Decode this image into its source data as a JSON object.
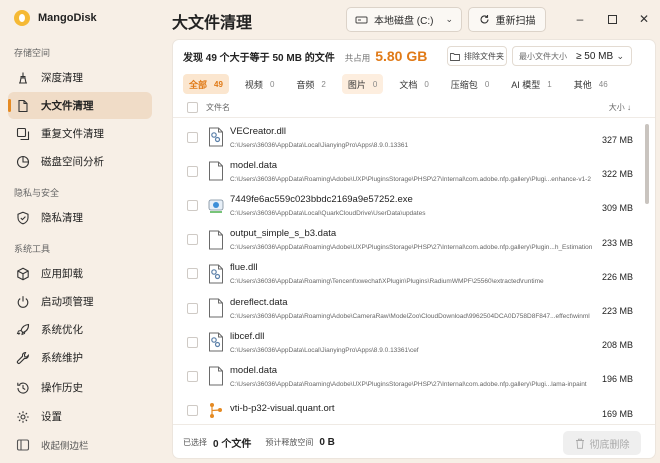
{
  "app": {
    "name": "MangoDisk"
  },
  "sidebar": {
    "sections": [
      {
        "title": "存储空间",
        "items": [
          {
            "label": "深度清理",
            "icon": "broom-icon",
            "active": false
          },
          {
            "label": "大文件清理",
            "icon": "large-file-icon",
            "active": true
          },
          {
            "label": "重复文件清理",
            "icon": "duplicate-icon",
            "active": false
          },
          {
            "label": "磁盘空间分析",
            "icon": "pie-chart-icon",
            "active": false
          }
        ]
      },
      {
        "title": "隐私与安全",
        "items": [
          {
            "label": "隐私清理",
            "icon": "shield-icon",
            "active": false
          }
        ]
      },
      {
        "title": "系统工具",
        "items": [
          {
            "label": "应用卸载",
            "icon": "box-icon",
            "active": false
          },
          {
            "label": "启动项管理",
            "icon": "power-icon",
            "active": false
          },
          {
            "label": "系统优化",
            "icon": "rocket-icon",
            "active": false
          },
          {
            "label": "系统维护",
            "icon": "wrench-icon",
            "active": false
          }
        ]
      }
    ],
    "bottom": [
      {
        "label": "操作历史",
        "icon": "history-icon"
      },
      {
        "label": "设置",
        "icon": "gear-icon"
      }
    ],
    "collapse_label": "收起侧边栏"
  },
  "header": {
    "title": "大文件清理",
    "disk": "本地磁盘 (C:)",
    "rescan": "重新扫描"
  },
  "summary": {
    "found": "发现 49 个大于等于 50 MB 的文件",
    "total_label": "共占用",
    "total": "5.80 GB",
    "exclude_label": "排除文件夹",
    "min_size_label": "最小文件大小",
    "min_size_value": "≥ 50 MB"
  },
  "tabs": [
    {
      "label": "全部",
      "count": "49",
      "active": true
    },
    {
      "label": "视频",
      "count": "0"
    },
    {
      "label": "音频",
      "count": "2"
    },
    {
      "label": "图片",
      "count": "0",
      "highlight": true
    },
    {
      "label": "文档",
      "count": "0"
    },
    {
      "label": "压缩包",
      "count": "0"
    },
    {
      "label": "AI 模型",
      "count": "1"
    },
    {
      "label": "其他",
      "count": "46"
    }
  ],
  "columns": {
    "name": "文件名",
    "size": "大小 ↓"
  },
  "files": [
    {
      "name": "VECreator.dll",
      "path": "C:\\Users\\36036\\AppData\\Local\\JianyingPro\\Apps\\8.9.0.13361",
      "size": "327 MB",
      "icon": "dll-file-icon"
    },
    {
      "name": "model.data",
      "path": "C:\\Users\\36036\\AppData\\Roaming\\Adobe\\UXP\\PluginsStorage\\PHSP\\27\\Internal\\com.adobe.nfp.gallery\\Plugi...enhance-v1-2",
      "size": "322 MB",
      "icon": "file-icon"
    },
    {
      "name": "7449fe6ac559c023bbdc2169a9e57252.exe",
      "path": "C:\\Users\\36036\\AppData\\Local\\QuarkCloudDrive\\UserData\\updates",
      "size": "309 MB",
      "icon": "exe-file-icon"
    },
    {
      "name": "output_simple_s_b3.data",
      "path": "C:\\Users\\36036\\AppData\\Roaming\\Adobe\\UXP\\PluginsStorage\\PHSP\\27\\Internal\\com.adobe.nfp.gallery\\Plugin...h_Estimation",
      "size": "233 MB",
      "icon": "file-icon"
    },
    {
      "name": "flue.dll",
      "path": "C:\\Users\\36036\\AppData\\Roaming\\Tencent\\xwechat\\XPlugin\\Plugins\\RadiumWMPF\\25560\\extracted\\runtime",
      "size": "226 MB",
      "icon": "dll-file-icon"
    },
    {
      "name": "dereflect.data",
      "path": "C:\\Users\\36036\\AppData\\Roaming\\Adobe\\CameraRaw\\ModelZoo\\CloudDownload\\9962504DCA0D758D8F847...effect\\winml",
      "size": "223 MB",
      "icon": "file-icon"
    },
    {
      "name": "libcef.dll",
      "path": "C:\\Users\\36036\\AppData\\Local\\JianyingPro\\Apps\\8.9.0.13361\\cef",
      "size": "208 MB",
      "icon": "dll-file-icon"
    },
    {
      "name": "model.data",
      "path": "C:\\Users\\36036\\AppData\\Roaming\\Adobe\\UXP\\PluginsStorage\\PHSP\\27\\Internal\\com.adobe.nfp.gallery\\Plugi...lama-inpaint",
      "size": "196 MB",
      "icon": "file-icon"
    },
    {
      "name": "vti-b-p32-visual.quant.ort",
      "path": "",
      "size": "169 MB",
      "icon": "model-file-icon"
    }
  ],
  "footer": {
    "selected_label": "已选择",
    "selected_value": "0 个文件",
    "free_label": "预计释放空间",
    "free_value": "0 B",
    "delete_label": "彻底删除"
  },
  "colors": {
    "accent": "#e58a23",
    "sidebar_bg": "#f7efe6",
    "active_bg": "#f0dcc7"
  }
}
